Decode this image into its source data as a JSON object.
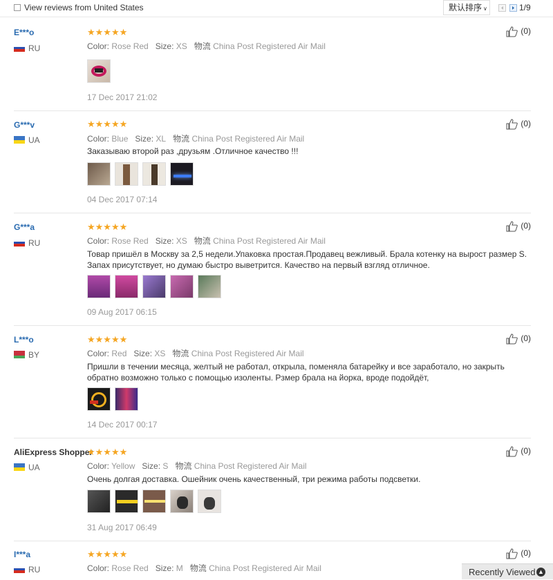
{
  "filter": {
    "label": "View reviews from United States"
  },
  "sort": {
    "label": "默认排序"
  },
  "pagination": {
    "text": "1/9"
  },
  "field_labels": {
    "color": "Color:",
    "size": "Size:",
    "ship_cn": "物流"
  },
  "reviews": [
    {
      "user": "E***o",
      "country": "RU",
      "stars": "★★★★★",
      "color": "Rose Red",
      "size": "XS",
      "shipping": "China Post Registered Air Mail",
      "text": "",
      "date": "17 Dec 2017 21:02",
      "helpful": "(0)"
    },
    {
      "user": "G***v",
      "country": "UA",
      "stars": "★★★★★",
      "color": "Blue",
      "size": "XL",
      "shipping": "China Post Registered Air Mail",
      "text": "Заказываю второй раз ,друзьям .Отличное качество !!!",
      "date": "04 Dec 2017 07:14",
      "helpful": "(0)"
    },
    {
      "user": "G***a",
      "country": "RU",
      "stars": "★★★★★",
      "color": "Rose Red",
      "size": "XS",
      "shipping": "China Post Registered Air Mail",
      "text": "Товар пришёл в Москву за 2,5 недели.Упаковка простая.Продавец вежливый. Брала котенку на вырост размер S. Запах присутствует, но думаю быстро выветрится. Качество на первый взгляд отличное.",
      "date": "09 Aug 2017 06:15",
      "helpful": "(0)"
    },
    {
      "user": "L***o",
      "country": "BY",
      "stars": "★★★★★",
      "color": "Red",
      "size": "XS",
      "shipping": "China Post Registered Air Mail",
      "text": "Пришли в течении месяца, желтый не работал, открыла, поменяла батарейку и все заработало, но закрыть обратно возможно только с помощью изоленты. Рзмер брала на йорка, вроде подойдёт,",
      "date": "14 Dec 2017 00:17",
      "helpful": "(0)"
    },
    {
      "user": "AliExpress Shopper",
      "country": "UA",
      "stars": "★★★★★",
      "color": "Yellow",
      "size": "S",
      "shipping": "China Post Registered Air Mail",
      "text": "Очень долгая доставка. Ошейник очень качественный, три режима работы подсветки.",
      "date": "31 Aug 2017 06:49",
      "helpful": "(0)"
    },
    {
      "user": "I***a",
      "country": "RU",
      "stars": "★★★★★",
      "color": "Rose Red",
      "size": "M",
      "shipping": "China Post Registered Air Mail",
      "text": "",
      "date": "",
      "helpful": "(0)"
    }
  ],
  "recently_viewed": {
    "label": "Recently Viewed"
  }
}
